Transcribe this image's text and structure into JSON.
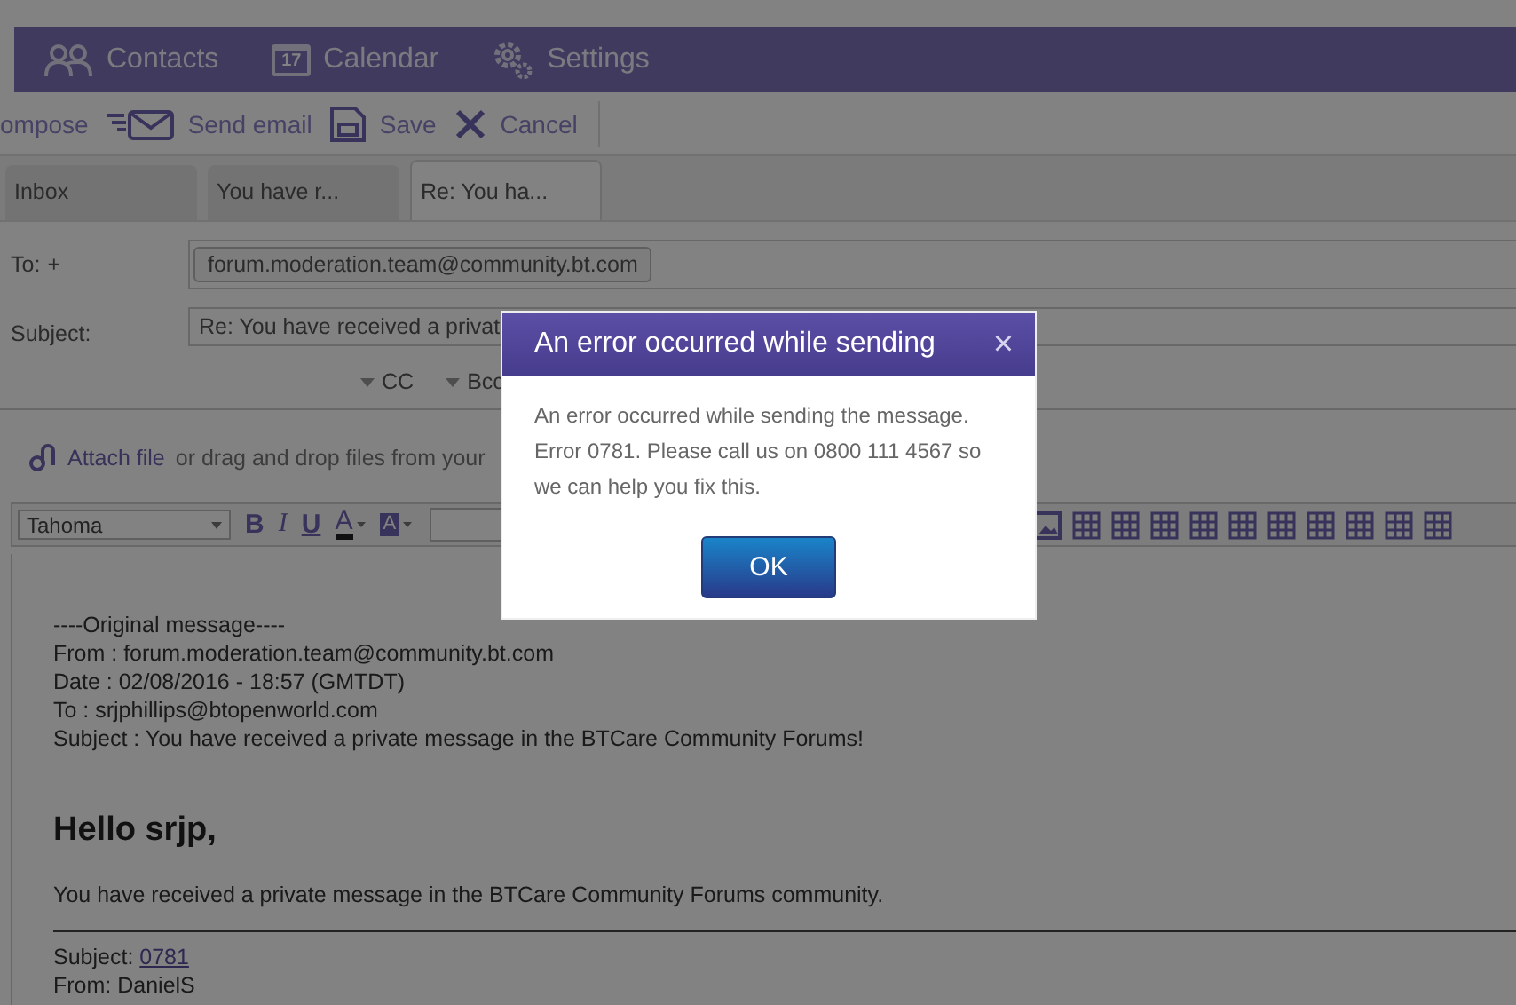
{
  "nav": {
    "items": [
      {
        "kind": "contacts",
        "label": "Contacts"
      },
      {
        "kind": "calendar",
        "label": "Calendar",
        "icon_text": "17"
      },
      {
        "kind": "settings",
        "label": "Settings"
      }
    ]
  },
  "toolbar": {
    "buttons": [
      {
        "kind": "compose",
        "label": "ompose"
      },
      {
        "kind": "send",
        "label": "Send email"
      },
      {
        "kind": "save",
        "label": "Save"
      },
      {
        "kind": "cancel",
        "label": "Cancel"
      }
    ]
  },
  "tabs": [
    {
      "label": "Inbox",
      "selected": false
    },
    {
      "label": "You have r...",
      "selected": false
    },
    {
      "label": "Re: You ha...",
      "selected": true
    }
  ],
  "compose": {
    "to_label": "To:",
    "to_add": "+",
    "recipients": [
      "forum.moderation.team@community.bt.com"
    ],
    "subject_label": "Subject:",
    "subject": "Re: You have received a privat",
    "cc": "CC",
    "bcc": "Bcc"
  },
  "attach": {
    "link": "Attach file",
    "text": "or drag and drop files from your"
  },
  "editor_toolbar": {
    "font": "Tahoma",
    "format_buttons": [
      {
        "kind": "bold",
        "label": "B"
      },
      {
        "kind": "italic",
        "label": "I"
      },
      {
        "kind": "underline",
        "label": "U"
      },
      {
        "kind": "font-color",
        "label": "A"
      },
      {
        "kind": "highlight",
        "label": "A"
      }
    ]
  },
  "message": {
    "header_lines": [
      "----Original message----",
      "From : forum.moderation.team@community.bt.com",
      "Date : 02/08/2016 - 18:57 (GMTDT)",
      "To : srjphillips@btopenworld.com",
      "Subject : You have received a private message in the BTCare Community Forums!"
    ],
    "greeting": "Hello srjp,",
    "intro": "You have received a private message in the BTCare Community Forums community.",
    "details": [
      {
        "label": "Subject:",
        "value": "0781",
        "link": true
      },
      {
        "label": "From:",
        "value": "DanielS",
        "link": false
      }
    ]
  },
  "dialog": {
    "title": "An error occurred while sending",
    "close": "×",
    "message": "An error occurred while sending the message. Error 0781. Please call us on 0800 111 4567 so we can help you fix this.",
    "ok": "OK"
  }
}
